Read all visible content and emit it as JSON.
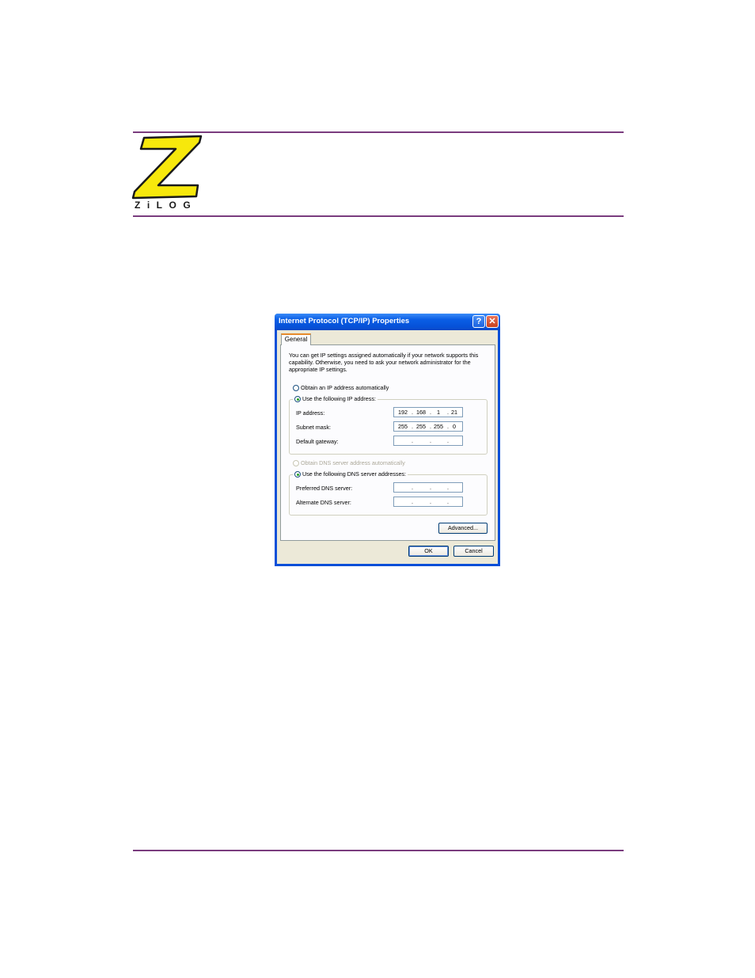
{
  "logo": {
    "wordmark": "ZiLOG",
    "colors": {
      "fill": "#f7e80c",
      "outline": "#1a1a1a",
      "rule": "#7a3c7e"
    }
  },
  "dialog": {
    "title": "Internet Protocol (TCP/IP) Properties",
    "help_button": "?",
    "close_button": "✕",
    "tab": "General",
    "description": "You can get IP settings assigned automatically if your network supports this capability. Otherwise, you need to ask your network administrator for the appropriate IP settings.",
    "ip_options": {
      "auto_label": "Obtain an IP address automatically",
      "auto_selected": false,
      "manual_label": "Use the following IP address:",
      "manual_selected": true
    },
    "ip_fields": {
      "ip_address": {
        "label": "IP address:",
        "octets": [
          "192",
          "168",
          "1",
          "21"
        ]
      },
      "subnet_mask": {
        "label": "Subnet mask:",
        "octets": [
          "255",
          "255",
          "255",
          "0"
        ]
      },
      "default_gateway": {
        "label": "Default gateway:",
        "octets": [
          "",
          "",
          "",
          ""
        ]
      }
    },
    "dns_options": {
      "auto_label": "Obtain DNS server address automatically",
      "auto_enabled": false,
      "manual_label": "Use the following DNS server addresses:",
      "manual_selected": true
    },
    "dns_fields": {
      "preferred": {
        "label": "Preferred DNS server:",
        "octets": [
          "",
          "",
          "",
          ""
        ]
      },
      "alternate": {
        "label": "Alternate DNS server:",
        "octets": [
          "",
          "",
          "",
          ""
        ]
      }
    },
    "buttons": {
      "advanced": "Advanced...",
      "ok": "OK",
      "cancel": "Cancel"
    }
  }
}
